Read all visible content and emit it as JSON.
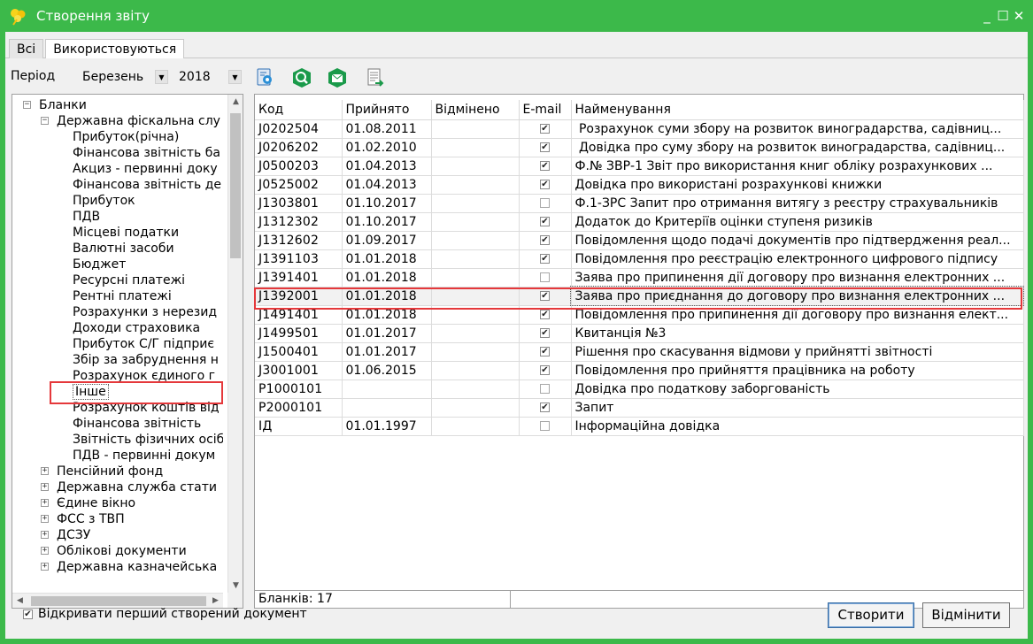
{
  "window": {
    "title": "Створення звіту",
    "controls": [
      "_",
      "☐",
      "✕"
    ]
  },
  "tabs": [
    {
      "label": "Всі",
      "active": false
    },
    {
      "label": "Використовуються",
      "active": true
    }
  ],
  "toolbar": {
    "period_label": "Період",
    "month": "Березень",
    "year": "2018",
    "buttons": [
      "settings-icon",
      "search-icon",
      "email-icon",
      "export-icon"
    ]
  },
  "tree": [
    {
      "label": "Бланки",
      "level": 0,
      "expander": "−"
    },
    {
      "label": "Державна фіскальна слу",
      "level": 1,
      "expander": "−"
    },
    {
      "label": "Прибуток(річна)",
      "level": 2
    },
    {
      "label": "Фінансова звітність ба",
      "level": 2
    },
    {
      "label": "Акциз - первинні доку",
      "level": 2
    },
    {
      "label": "Фінансова звітність де",
      "level": 2
    },
    {
      "label": "Прибуток",
      "level": 2
    },
    {
      "label": "ПДВ",
      "level": 2
    },
    {
      "label": "Місцеві податки",
      "level": 2
    },
    {
      "label": "Валютні засоби",
      "level": 2
    },
    {
      "label": "Бюджет",
      "level": 2
    },
    {
      "label": "Ресурсні платежі",
      "level": 2
    },
    {
      "label": "Рентні платежі",
      "level": 2
    },
    {
      "label": "Розрахунки з нерезид",
      "level": 2
    },
    {
      "label": "Доходи страховика",
      "level": 2
    },
    {
      "label": "Прибуток С/Г підприє",
      "level": 2
    },
    {
      "label": "Збір за забруднення н",
      "level": 2
    },
    {
      "label": "Розрахунок єдиного г",
      "level": 2
    },
    {
      "label": "Інше",
      "level": 2,
      "selected": true
    },
    {
      "label": "Розрахунок коштів від",
      "level": 2
    },
    {
      "label": "Фінансова звітність",
      "level": 2
    },
    {
      "label": "Звітність фізичних осіб",
      "level": 2
    },
    {
      "label": "ПДВ - первинні докум",
      "level": 2
    },
    {
      "label": "Пенсійний фонд",
      "level": 1,
      "expander": "+"
    },
    {
      "label": "Державна служба стати",
      "level": 1,
      "expander": "+"
    },
    {
      "label": "Єдине вікно",
      "level": 1,
      "expander": "+"
    },
    {
      "label": "ФСС з ТВП",
      "level": 1,
      "expander": "+"
    },
    {
      "label": "ДСЗУ",
      "level": 1,
      "expander": "+"
    },
    {
      "label": "Облікові документи",
      "level": 1,
      "expander": "+"
    },
    {
      "label": "Державна казначейська",
      "level": 1,
      "expander": "+"
    }
  ],
  "grid": {
    "columns": [
      "Код",
      "Прийнято",
      "Відмінено",
      "E-mail",
      "Найменування"
    ],
    "rows": [
      {
        "code": "J0202504",
        "accepted": "01.08.2011",
        "cancelled": "",
        "email": true,
        "name": " Розрахунок суми збору на розвиток виноградарства, садівниц..."
      },
      {
        "code": "J0206202",
        "accepted": "01.02.2010",
        "cancelled": "",
        "email": true,
        "name": " Довідка про суму збору на розвиток виноградарства, садівниц..."
      },
      {
        "code": "J0500203",
        "accepted": "01.04.2013",
        "cancelled": "",
        "email": true,
        "name": "Ф.№ ЗВР-1 Звіт про використання книг обліку розрахункових ..."
      },
      {
        "code": "J0525002",
        "accepted": "01.04.2013",
        "cancelled": "",
        "email": true,
        "name": "Довідка про використані розрахункові книжки"
      },
      {
        "code": "J1303801",
        "accepted": "01.10.2017",
        "cancelled": "",
        "email": false,
        "name": "Ф.1-ЗРС Запит про отримання витягу з реєстру страхувальників"
      },
      {
        "code": "J1312302",
        "accepted": "01.10.2017",
        "cancelled": "",
        "email": true,
        "name": "Додаток до Критеріїв оцінки ступеня ризиків"
      },
      {
        "code": "J1312602",
        "accepted": "01.09.2017",
        "cancelled": "",
        "email": true,
        "name": "Повідомлення щодо подачі документів про підтвердження реал..."
      },
      {
        "code": "J1391103",
        "accepted": "01.01.2018",
        "cancelled": "",
        "email": true,
        "name": "Повідомлення про реєстрацію електронного цифрового підпису"
      },
      {
        "code": "J1391401",
        "accepted": "01.01.2018",
        "cancelled": "",
        "email": false,
        "name": "Заява про припинення дії договору про визнання електронних ..."
      },
      {
        "code": "J1392001",
        "accepted": "01.01.2018",
        "cancelled": "",
        "email": true,
        "name": "Заява про приєднання до договору про визнання електронних ...",
        "selected": true
      },
      {
        "code": "J1491401",
        "accepted": "01.01.2018",
        "cancelled": "",
        "email": true,
        "name": "Повідомлення про припинення дії договору про визнання елект..."
      },
      {
        "code": "J1499501",
        "accepted": "01.01.2017",
        "cancelled": "",
        "email": true,
        "name": "Квитанція №3"
      },
      {
        "code": "J1500401",
        "accepted": "01.01.2017",
        "cancelled": "",
        "email": true,
        "name": "Рішення про скасування відмови у прийнятті звітності"
      },
      {
        "code": "J3001001",
        "accepted": "01.06.2015",
        "cancelled": "",
        "email": true,
        "name": "Повідомлення про прийняття працівника на роботу"
      },
      {
        "code": "P1000101",
        "accepted": "",
        "cancelled": "",
        "email": false,
        "name": "Довідка про податкову заборгованість"
      },
      {
        "code": "P2000101",
        "accepted": "",
        "cancelled": "",
        "email": true,
        "name": "Запит"
      },
      {
        "code": "ІД",
        "accepted": "01.01.1997",
        "cancelled": "",
        "email": false,
        "name": "Інформаційна довідка"
      }
    ],
    "count_label": "Бланків: 17"
  },
  "footer": {
    "open_first_label": "Відкривати перший створений документ",
    "open_first_checked": true,
    "create_label": "Створити",
    "cancel_label": "Відмінити"
  },
  "colors": {
    "frame": "#3cb94a",
    "highlight": "#e5383b"
  }
}
